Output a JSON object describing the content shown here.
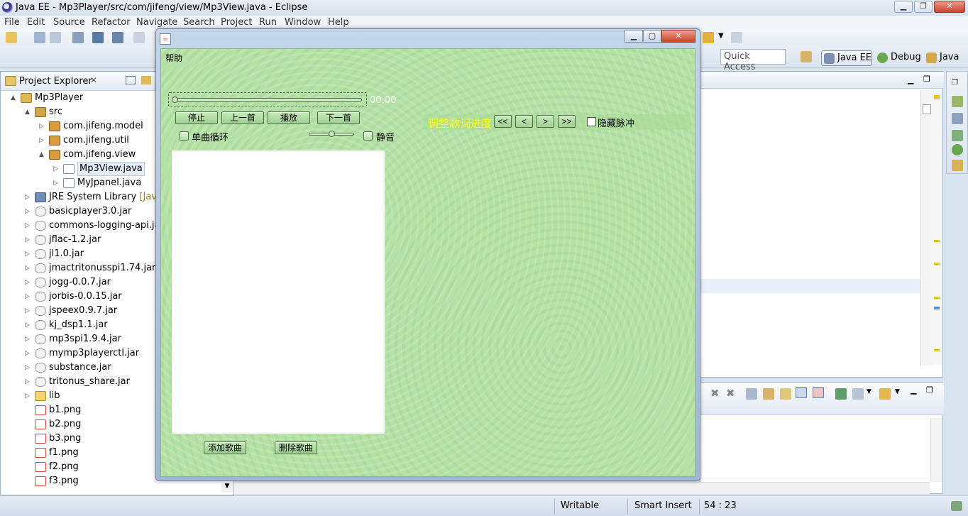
{
  "eclipse": {
    "title": "Java EE - Mp3Player/src/com/jifeng/view/Mp3View.java - Eclipse",
    "menu": [
      "File",
      "Edit",
      "Source",
      "Refactor",
      "Navigate",
      "Search",
      "Project",
      "Run",
      "Window",
      "Help"
    ],
    "quick_access_placeholder": "Quick Access",
    "perspectives": [
      "Java EE",
      "Debug",
      "Java"
    ]
  },
  "project_explorer": {
    "tab_label": "Project Explorer",
    "tab_close": "✕",
    "items": [
      {
        "label": "Mp3Player",
        "suffix": "",
        "icon": "project-icon",
        "arrow": "▲",
        "level": 0
      },
      {
        "label": "src",
        "suffix": "",
        "icon": "source-folder-icon",
        "arrow": "▲",
        "level": 1
      },
      {
        "label": "com.jifeng.model",
        "suffix": "",
        "icon": "package-icon",
        "arrow": "▷",
        "level": 2
      },
      {
        "label": "com.jifeng.util",
        "suffix": "",
        "icon": "package-icon",
        "arrow": "▷",
        "level": 2
      },
      {
        "label": "com.jifeng.view",
        "suffix": "",
        "icon": "package-icon",
        "arrow": "▲",
        "level": 2
      },
      {
        "label": "Mp3View.java",
        "suffix": "",
        "icon": "java-file-icon",
        "arrow": "▷",
        "level": 3,
        "selected": true
      },
      {
        "label": "MyJpanel.java",
        "suffix": "",
        "icon": "java-file-icon",
        "arrow": "▷",
        "level": 3
      },
      {
        "label": "JRE System Library ",
        "suffix": "[JavaSE",
        "icon": "library-icon",
        "arrow": "▷",
        "level": 1
      },
      {
        "label": "basicplayer3.0.jar",
        "suffix": "",
        "icon": "jar-icon",
        "arrow": "▷",
        "level": 1
      },
      {
        "label": "commons-logging-api.jar",
        "suffix": "",
        "icon": "jar-icon",
        "arrow": "▷",
        "level": 1
      },
      {
        "label": "jflac-1.2.jar",
        "suffix": "",
        "icon": "jar-icon",
        "arrow": "▷",
        "level": 1
      },
      {
        "label": "jl1.0.jar",
        "suffix": "",
        "icon": "jar-icon",
        "arrow": "▷",
        "level": 1
      },
      {
        "label": "jmactritonusspi1.74.jar",
        "suffix": "",
        "icon": "jar-icon",
        "arrow": "▷",
        "level": 1
      },
      {
        "label": "jogg-0.0.7.jar",
        "suffix": "",
        "icon": "jar-icon",
        "arrow": "▷",
        "level": 1
      },
      {
        "label": "jorbis-0.0.15.jar",
        "suffix": "",
        "icon": "jar-icon",
        "arrow": "▷",
        "level": 1
      },
      {
        "label": "jspeex0.9.7.jar",
        "suffix": "",
        "icon": "jar-icon",
        "arrow": "▷",
        "level": 1
      },
      {
        "label": "kj_dsp1.1.jar",
        "suffix": "",
        "icon": "jar-icon",
        "arrow": "▷",
        "level": 1
      },
      {
        "label": "mp3spi1.9.4.jar",
        "suffix": "",
        "icon": "jar-icon",
        "arrow": "▷",
        "level": 1
      },
      {
        "label": "mymp3playerctl.jar",
        "suffix": "",
        "icon": "jar-icon",
        "arrow": "▷",
        "level": 1
      },
      {
        "label": "substance.jar",
        "suffix": "",
        "icon": "jar-icon",
        "arrow": "▷",
        "level": 1
      },
      {
        "label": "tritonus_share.jar",
        "suffix": "",
        "icon": "jar-icon",
        "arrow": "▷",
        "level": 1
      },
      {
        "label": "lib",
        "suffix": "",
        "icon": "folder-icon",
        "arrow": "▷",
        "level": 1
      },
      {
        "label": "b1.png",
        "suffix": "",
        "icon": "png-file-icon",
        "arrow": "",
        "level": 1
      },
      {
        "label": "b2.png",
        "suffix": "",
        "icon": "png-file-icon",
        "arrow": "",
        "level": 1
      },
      {
        "label": "b3.png",
        "suffix": "",
        "icon": "png-file-icon",
        "arrow": "",
        "level": 1
      },
      {
        "label": "f1.png",
        "suffix": "",
        "icon": "png-file-icon",
        "arrow": "",
        "level": 1
      },
      {
        "label": "f2.png",
        "suffix": "",
        "icon": "png-file-icon",
        "arrow": "",
        "level": 1
      },
      {
        "label": "f3.png",
        "suffix": "",
        "icon": "png-file-icon",
        "arrow": "",
        "level": 1
      }
    ]
  },
  "statusbar": {
    "writable": "Writable",
    "insert_mode": "Smart Insert",
    "cursor_position": "54 : 23"
  },
  "player": {
    "menu_help": "帮助",
    "time": "00:00",
    "progress": 0,
    "volume": 0.5,
    "buttons": {
      "stop": "停止",
      "previous": "上一首",
      "play": "播放",
      "next": "下一首",
      "add_song": "添加歌曲",
      "delete_song": "删除歌曲"
    },
    "single_loop_label": "单曲循环",
    "mute_label": "静音",
    "lyric_adjust_label": "调整歌词进度",
    "lyric_buttons": [
      "<<",
      "<",
      ">",
      ">>"
    ],
    "hide_pulse_label": "隐藏脉冲",
    "colors": {
      "background": "#b4e1a4",
      "lyric_label": "#ffff00",
      "time_label": "#ffffff"
    }
  }
}
